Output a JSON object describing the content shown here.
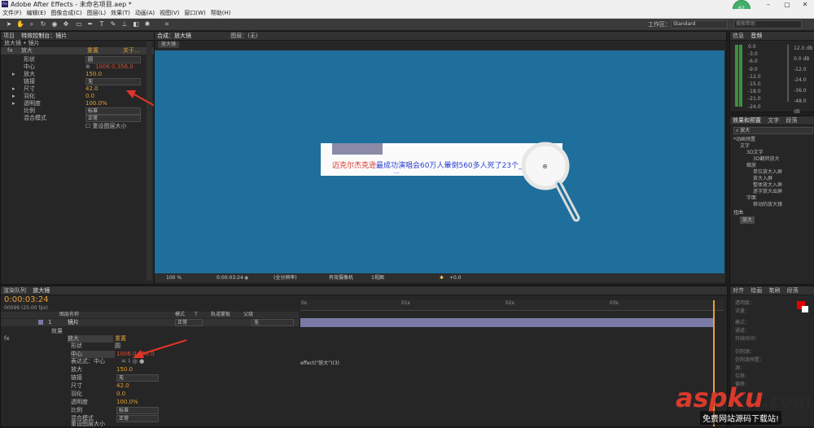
{
  "window": {
    "title": "Adobe After Effects - 未命名项目.aep *",
    "logo": "Ae",
    "minimize": "–",
    "maximize": "▢",
    "close": "✕",
    "badge": "62"
  },
  "menu": [
    "文件(F)",
    "编辑(E)",
    "图像合成(C)",
    "图层(L)",
    "效果(T)",
    "动画(A)",
    "视图(V)",
    "窗口(W)",
    "帮助(H)"
  ],
  "toolbar": {
    "workspace_label": "工作区：",
    "workspace_value": "Standard",
    "search_placeholder": "搜索帮助"
  },
  "project_panel": {
    "tabs": [
      "项目",
      "特效控制台：镜片"
    ],
    "breadcrumb": "放大镜 • 镜片",
    "effect_row": {
      "fx": "fx",
      "name": "放大",
      "reset": "重置",
      "about": "关于..."
    },
    "props": [
      {
        "name": "形状",
        "kind": "dropdown",
        "value": "圆"
      },
      {
        "name": "中心",
        "kind": "point",
        "value": "1006.0,356.0"
      },
      {
        "name": "放大",
        "kind": "number",
        "value": "150.0"
      },
      {
        "name": "链接",
        "kind": "dropdown",
        "value": "无"
      },
      {
        "name": "尺寸",
        "kind": "number",
        "value": "42.0"
      },
      {
        "name": "羽化",
        "kind": "number",
        "value": "0.0"
      },
      {
        "name": "透明度",
        "kind": "number",
        "value": "100.0%"
      },
      {
        "name": "比例",
        "kind": "dropdown",
        "value": "标准"
      },
      {
        "name": "混合模式",
        "kind": "dropdown",
        "value": "正常"
      }
    ],
    "checkbox_label": "重设图层大小"
  },
  "viewer": {
    "tab_label": "合成：放大镜",
    "layer_tab": "图层：(无)",
    "comp_label": "放大镜",
    "headline_red": "迈克尔杰克逊",
    "headline_blue": "最成功演唱会60万人暈倒560多人死了23个_标-音...",
    "second_line": "...",
    "footer": {
      "zoom": "100 %",
      "time": "0:00:03:24",
      "res": "(全分辨率)",
      "camera": "有效摄像机",
      "views": "1视图",
      "exposure": "+0.0"
    }
  },
  "info_panel": {
    "tabs": [
      "信息",
      "音频"
    ],
    "db_left": [
      "0.0",
      "-3.0",
      "-6.0",
      "-9.0",
      "-12.0",
      "-15.0",
      "-18.0",
      "-21.0",
      "-24.0"
    ],
    "db_right": [
      "12.0 dB",
      "0.0 dB",
      "-12.0",
      "-24.0",
      "-36.0",
      "-48.0 dB"
    ]
  },
  "effects_panel": {
    "tabs": [
      "效果和预置",
      "文字",
      "段落"
    ],
    "search_value": "放大",
    "tree": [
      {
        "label": "*动画预置",
        "indent": 0
      },
      {
        "label": "文字",
        "indent": 1
      },
      {
        "label": "3D文字",
        "indent": 2
      },
      {
        "label": "3D翻转放大",
        "indent": 3
      },
      {
        "label": "缩放",
        "indent": 2
      },
      {
        "label": "单位放大入屏",
        "indent": 3
      },
      {
        "label": "放大入屏",
        "indent": 3
      },
      {
        "label": "整体放大入屏",
        "indent": 3
      },
      {
        "label": "逐字放大出屏",
        "indent": 3
      },
      {
        "label": "字面",
        "indent": 2
      },
      {
        "label": "移动的放大镜",
        "indent": 3
      },
      {
        "label": "扭曲",
        "indent": 0
      },
      {
        "label": "放大",
        "indent": 1
      }
    ]
  },
  "timeline": {
    "tabs": [
      "渲染队列",
      "放大镜"
    ],
    "current_time": "0:00:03:24",
    "frames": "00099 (25.00 fps)",
    "columns": [
      "图层名称",
      "模式",
      "T",
      "轨道蒙板",
      "父级"
    ],
    "layer": {
      "index": "1",
      "name": "镜片",
      "mode": "正常",
      "parent": "无"
    },
    "effects_label": "效果",
    "effect_name": "放大",
    "reset": "重置",
    "props": [
      {
        "name": "形状",
        "value": "圆"
      },
      {
        "name": "中心",
        "value": "1006.0,356.0"
      },
      {
        "name": "表达式：中心",
        "value": ""
      },
      {
        "name": "放大",
        "value": "150.0"
      },
      {
        "name": "链接",
        "value": "无"
      },
      {
        "name": "尺寸",
        "value": "42.0"
      },
      {
        "name": "羽化",
        "value": "0.0"
      },
      {
        "name": "透明度",
        "value": "100.0%"
      },
      {
        "name": "比例",
        "value": "标准"
      },
      {
        "name": "混合模式",
        "value": "正常"
      },
      {
        "name": "重设图层大小",
        "value": ""
      }
    ],
    "ruler": [
      "0s",
      "01s",
      "02s",
      "03s"
    ],
    "expression": "effect(\"放大\")(3)"
  },
  "paragraph_panel": {
    "tabs": [
      "对齐",
      "绘画",
      "笔刷",
      "段落"
    ],
    "labels": [
      "透明度：",
      "流量：",
      "模式：",
      "通道：",
      "持续时间：",
      "仿制源：",
      "仿制源预置：",
      "源：",
      "位移：",
      "偏移："
    ]
  },
  "watermark": {
    "brand_red": "aspku",
    "brand_dark": ".com",
    "tagline": "免费网站源码下载站!"
  },
  "colors": {
    "viewer_bg": "#1e6f9c",
    "accent_red": "#d93a2b",
    "timebar": "#7a7aa6",
    "value_orange": "#e0a030"
  }
}
